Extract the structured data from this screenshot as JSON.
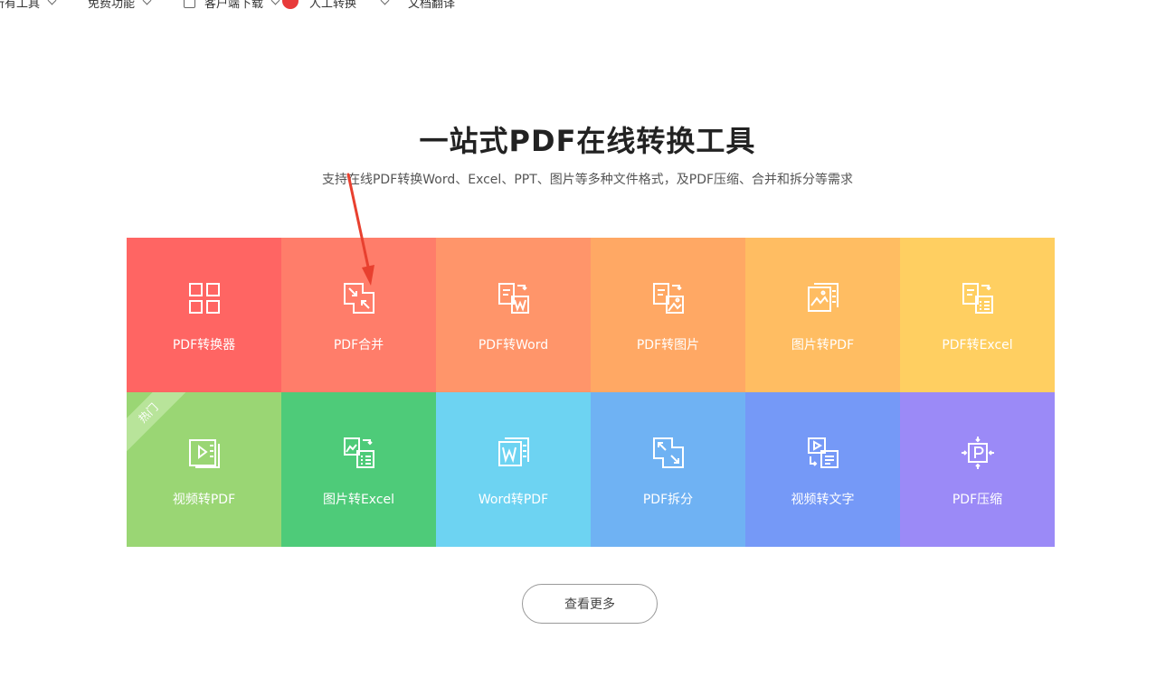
{
  "nav": {
    "items": [
      {
        "label": "所有工具"
      },
      {
        "label": "免费功能"
      },
      {
        "label": "客户端下载"
      },
      {
        "label": "人工转换"
      },
      {
        "label": "文档翻译"
      }
    ]
  },
  "hero": {
    "title": "一站式PDF在线转换工具",
    "subtitle": "支持在线PDF转换Word、Excel、PPT、图片等多种文件格式，及PDF压缩、合并和拆分等需求"
  },
  "tools": [
    {
      "label": "PDF转换器",
      "icon": "grid-icon",
      "color": "#ff6563"
    },
    {
      "label": "PDF合并",
      "icon": "merge-icon",
      "color": "#ff7d6a"
    },
    {
      "label": "PDF转Word",
      "icon": "pdf-to-word-icon",
      "color": "#ff956a"
    },
    {
      "label": "PDF转图片",
      "icon": "pdf-to-image-icon",
      "color": "#ffa864"
    },
    {
      "label": "图片转PDF",
      "icon": "image-to-pdf-icon",
      "color": "#ffbd62"
    },
    {
      "label": "PDF转Excel",
      "icon": "pdf-to-excel-icon",
      "color": "#ffcf61"
    },
    {
      "label": "视频转PDF",
      "icon": "video-to-pdf-icon",
      "color": "#9ad674",
      "badge": "热门"
    },
    {
      "label": "图片转Excel",
      "icon": "image-to-excel-icon",
      "color": "#4ecb79"
    },
    {
      "label": "Word转PDF",
      "icon": "word-to-pdf-icon",
      "color": "#6dd3f2"
    },
    {
      "label": "PDF拆分",
      "icon": "split-icon",
      "color": "#6fb2f3"
    },
    {
      "label": "视频转文字",
      "icon": "video-to-text-icon",
      "color": "#7599f7"
    },
    {
      "label": "PDF压缩",
      "icon": "compress-icon",
      "color": "#9b8af7"
    }
  ],
  "more_button": "查看更多",
  "annotation": {
    "arrow_color": "#e8402f"
  }
}
